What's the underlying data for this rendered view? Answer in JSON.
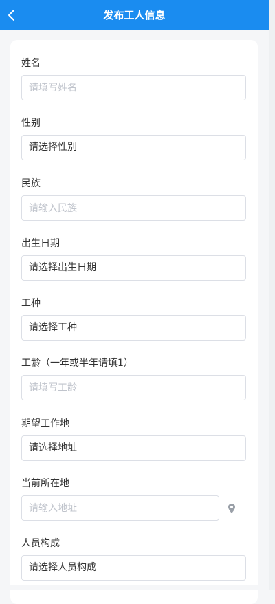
{
  "header": {
    "title": "发布工人信息"
  },
  "fields": [
    {
      "label": "姓名",
      "placeholder": "请填写姓名",
      "value": ""
    },
    {
      "label": "性别",
      "placeholder": "",
      "value": "请选择性别"
    },
    {
      "label": "民族",
      "placeholder": "请输入民族",
      "value": ""
    },
    {
      "label": "出生日期",
      "placeholder": "",
      "value": "请选择出生日期"
    },
    {
      "label": "工种",
      "placeholder": "",
      "value": "请选择工种"
    },
    {
      "label": "工龄（一年或半年请填1）",
      "placeholder": "请填写工龄",
      "value": ""
    },
    {
      "label": "期望工作地",
      "placeholder": "",
      "value": "请选择地址"
    },
    {
      "label": "当前所在地",
      "placeholder": "请输入地址",
      "value": ""
    },
    {
      "label": "人员构成",
      "placeholder": "",
      "value": "请选择人员构成"
    }
  ],
  "icons": {
    "back": "chevron-left-icon",
    "location": "location-pin-icon"
  },
  "colors": {
    "header": "#1a8cf0",
    "border": "#dcdfe6",
    "placeholder": "#c0c4cc",
    "text": "#333333"
  }
}
